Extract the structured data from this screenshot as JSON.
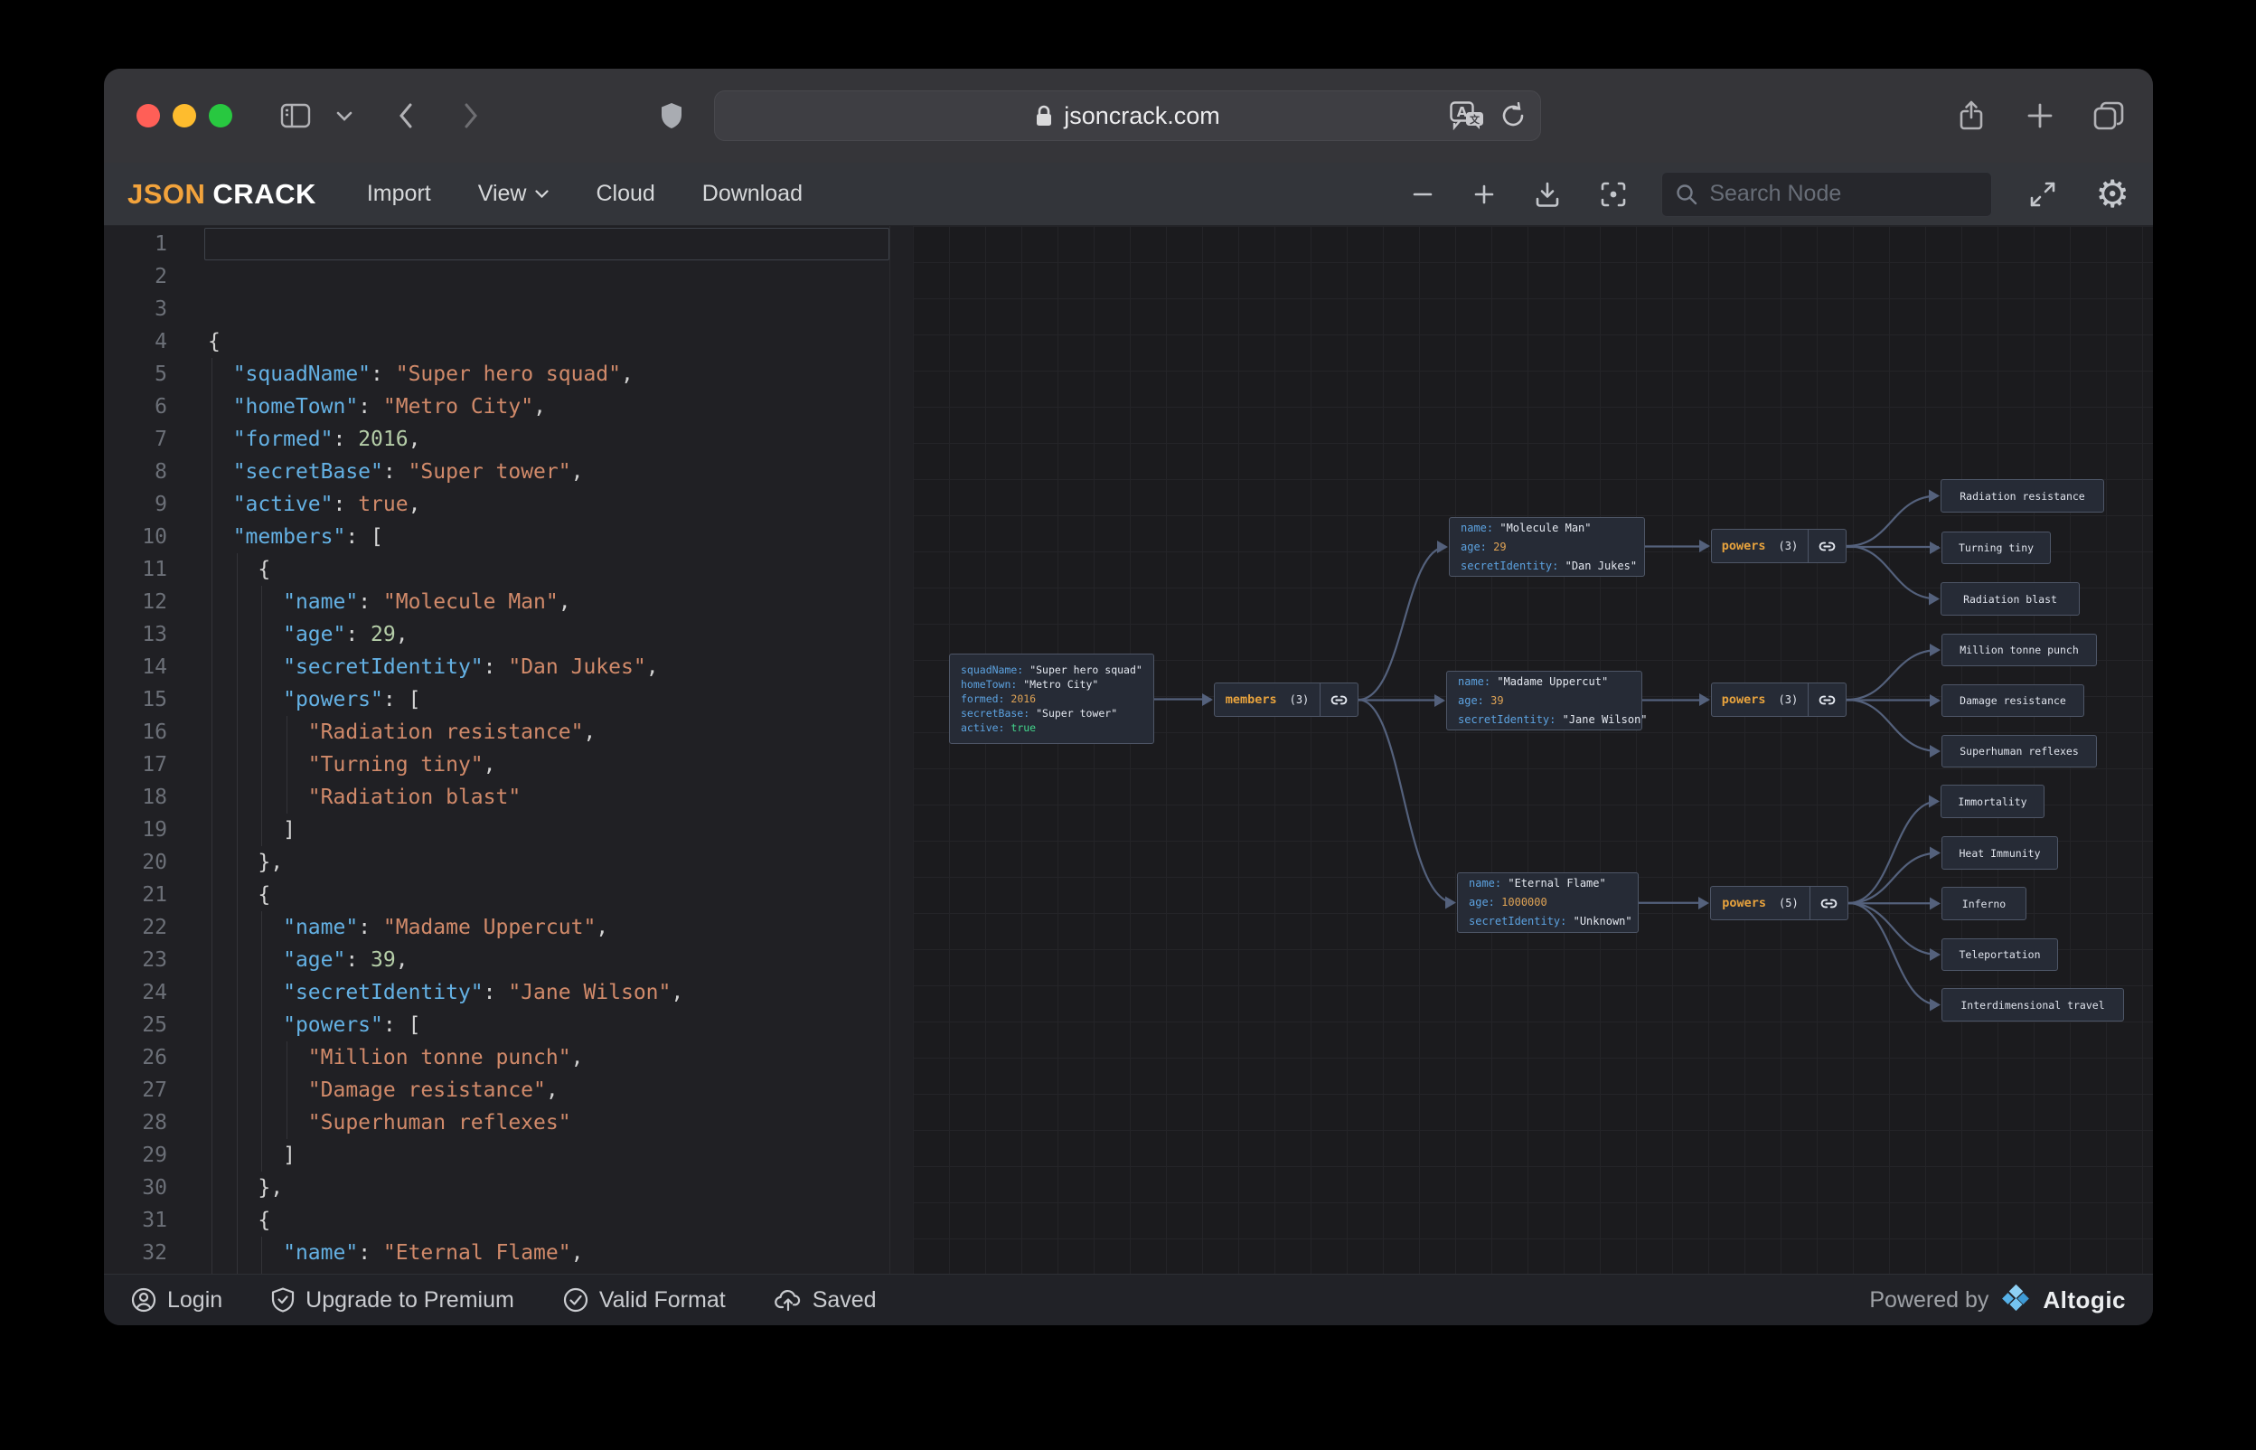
{
  "browser": {
    "url": "jsoncrack.com",
    "icons": [
      "sidebar",
      "back",
      "forward",
      "shield",
      "translate",
      "reload",
      "share",
      "new-tab",
      "tabs"
    ]
  },
  "toolbar": {
    "logo_part1": "JSON",
    "logo_part2": "CRACK",
    "menu": {
      "import": "Import",
      "view": "View",
      "cloud": "Cloud",
      "download": "Download"
    },
    "search_placeholder": "Search Node"
  },
  "editor": {
    "lines": [
      "{",
      "  \"squadName\": \"Super hero squad\",",
      "  \"homeTown\": \"Metro City\",",
      "  \"formed\": 2016,",
      "  \"secretBase\": \"Super tower\",",
      "  \"active\": true,",
      "  \"members\": [",
      "    {",
      "      \"name\": \"Molecule Man\",",
      "      \"age\": 29,",
      "      \"secretIdentity\": \"Dan Jukes\",",
      "      \"powers\": [",
      "        \"Radiation resistance\",",
      "        \"Turning tiny\",",
      "        \"Radiation blast\"",
      "      ]",
      "    },",
      "    {",
      "      \"name\": \"Madame Uppercut\",",
      "      \"age\": 39,",
      "      \"secretIdentity\": \"Jane Wilson\",",
      "      \"powers\": [",
      "        \"Million tonne punch\",",
      "        \"Damage resistance\",",
      "        \"Superhuman reflexes\"",
      "      ]",
      "    },",
      "    {",
      "      \"name\": \"Eternal Flame\",",
      "      \"age\": 1000000,",
      "      \"secretIdentity\": \"Unknown\",",
      "      \"powers\": ["
    ]
  },
  "graph": {
    "nodes": [
      {
        "id": "root",
        "kind": "object",
        "rowstyle": "grow-root",
        "rows": [
          {
            "k": "squadName",
            "v": "\"Super hero squad\"",
            "t": "str"
          },
          {
            "k": "homeTown",
            "v": "\"Metro City\"",
            "t": "str"
          },
          {
            "k": "formed",
            "v": "2016",
            "t": "num"
          },
          {
            "k": "secretBase",
            "v": "\"Super tower\"",
            "t": "str"
          },
          {
            "k": "active",
            "v": "true",
            "t": "bool"
          }
        ]
      },
      {
        "id": "members",
        "kind": "array",
        "label": "members",
        "count": "(3)"
      },
      {
        "id": "molecule",
        "kind": "object",
        "rowstyle": "grow-mem",
        "rows": [
          {
            "k": "name",
            "v": "\"Molecule Man\"",
            "t": "str"
          },
          {
            "k": "age",
            "v": "29",
            "t": "num"
          },
          {
            "k": "secretIdentity",
            "v": "\"Dan Jukes\"",
            "t": "str"
          }
        ]
      },
      {
        "id": "madame",
        "kind": "object",
        "rowstyle": "grow-mem",
        "rows": [
          {
            "k": "name",
            "v": "\"Madame Uppercut\"",
            "t": "str"
          },
          {
            "k": "age",
            "v": "39",
            "t": "num"
          },
          {
            "k": "secretIdentity",
            "v": "\"Jane Wilson\"",
            "t": "str"
          }
        ]
      },
      {
        "id": "eternal",
        "kind": "object",
        "rowstyle": "grow-mem",
        "rows": [
          {
            "k": "name",
            "v": "\"Eternal Flame\"",
            "t": "str"
          },
          {
            "k": "age",
            "v": "1000000",
            "t": "num"
          },
          {
            "k": "secretIdentity",
            "v": "\"Unknown\"",
            "t": "str"
          }
        ]
      },
      {
        "id": "powers1",
        "kind": "array",
        "label": "powers",
        "count": "(3)"
      },
      {
        "id": "powers2",
        "kind": "array",
        "label": "powers",
        "count": "(3)"
      },
      {
        "id": "powers3",
        "kind": "array",
        "label": "powers",
        "count": "(5)"
      },
      {
        "id": "leaf1",
        "kind": "leaf",
        "label": "Radiation resistance"
      },
      {
        "id": "leaf2",
        "kind": "leaf",
        "label": "Turning tiny"
      },
      {
        "id": "leaf3",
        "kind": "leaf",
        "label": "Radiation blast"
      },
      {
        "id": "leaf4",
        "kind": "leaf",
        "label": "Million tonne punch"
      },
      {
        "id": "leaf5",
        "kind": "leaf",
        "label": "Damage resistance"
      },
      {
        "id": "leaf6",
        "kind": "leaf",
        "label": "Superhuman reflexes"
      },
      {
        "id": "leaf7",
        "kind": "leaf",
        "label": "Immortality"
      },
      {
        "id": "leaf8",
        "kind": "leaf",
        "label": "Heat Immunity"
      },
      {
        "id": "leaf9",
        "kind": "leaf",
        "label": "Inferno"
      },
      {
        "id": "leaf10",
        "kind": "leaf",
        "label": "Teleportation"
      },
      {
        "id": "leaf11",
        "kind": "leaf",
        "label": "Interdimensional travel"
      }
    ]
  },
  "footer": {
    "login": "Login",
    "upgrade": "Upgrade to Premium",
    "valid": "Valid Format",
    "saved": "Saved",
    "powered_by": "Powered by",
    "brand": "Altogic"
  },
  "colors": {
    "accent_orange": "#f2a33c",
    "node_border": "#4e5667",
    "edge": "#54617c",
    "key_blue": "#5ca2e0",
    "string_salmon": "#d18a6a",
    "number_green": "#b5cea8"
  }
}
